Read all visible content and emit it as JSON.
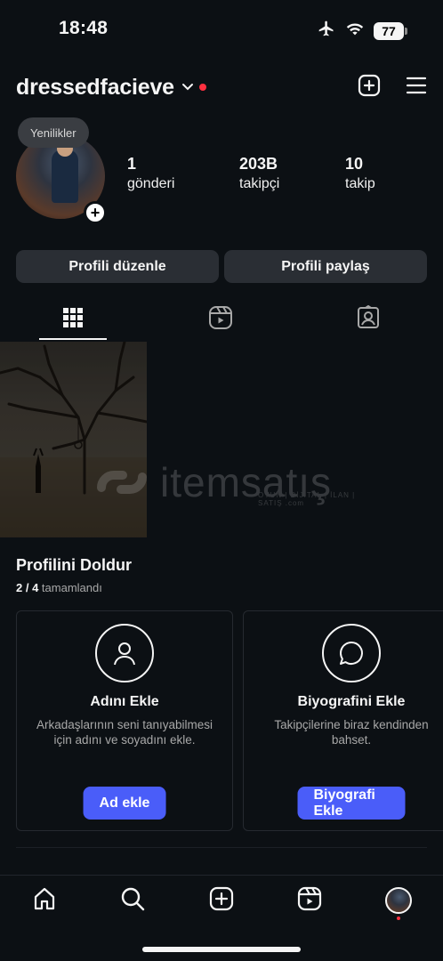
{
  "status_bar": {
    "time": "18:48",
    "battery": "77",
    "icons": [
      "airplane-icon",
      "wifi-icon",
      "battery-icon"
    ]
  },
  "header": {
    "username": "dressedfacieve",
    "icons": [
      "chevron-down-icon",
      "create-icon",
      "menu-icon"
    ],
    "notification_dot_color": "#ff3040"
  },
  "profile": {
    "notes_bubble": "Yenilikler",
    "add_story_symbol": "+",
    "stats": [
      {
        "value": "1",
        "label": "gönderi"
      },
      {
        "value": "203B",
        "label": "takipçi"
      },
      {
        "value": "10",
        "label": "takip"
      }
    ]
  },
  "actions": {
    "edit_profile": "Profili düzenle",
    "share_profile": "Profili paylaş"
  },
  "tabs": [
    {
      "name": "grid",
      "icon": "grid-icon",
      "active": true
    },
    {
      "name": "reels",
      "icon": "reels-icon",
      "active": false
    },
    {
      "name": "tagged",
      "icon": "tagged-icon",
      "active": false
    }
  ],
  "watermark": {
    "text": "itemsatış",
    "sub": "OYUN | DİJİTAL | İLAN | SATIŞ .com"
  },
  "complete_profile": {
    "title": "Profilini Doldur",
    "progress_count": "2 / 4",
    "progress_label": "tamamlandı",
    "cards": [
      {
        "icon": "person-icon",
        "title": "Adını Ekle",
        "description": "Arkadaşlarının seni tanıyabilmesi için adını ve soyadını ekle.",
        "button": "Ad ekle"
      },
      {
        "icon": "speech-bubble-icon",
        "title": "Biyografini Ekle",
        "description": "Takipçilerine biraz kendinden bahset.",
        "button": "Biyografi Ekle"
      }
    ]
  },
  "bottom_nav": [
    "home-icon",
    "search-icon",
    "create-icon",
    "reels-icon",
    "profile-avatar"
  ],
  "colors": {
    "background": "#0c1014",
    "button_bg": "#2a2e34",
    "accent_blue": "#4a5df9",
    "red_dot": "#ff3040"
  }
}
